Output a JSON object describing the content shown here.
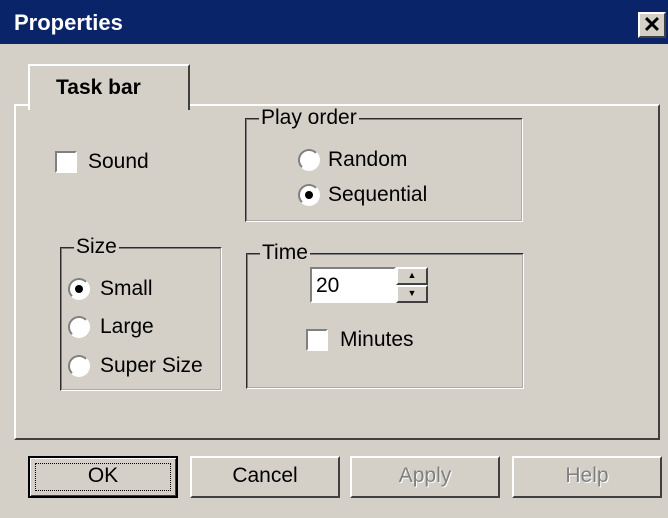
{
  "window": {
    "title": "Properties",
    "close_glyph": "✕"
  },
  "tabs": [
    {
      "label": "Task bar",
      "active": true
    }
  ],
  "sound": {
    "label": "Sound",
    "checked": false
  },
  "play_order": {
    "legend": "Play order",
    "options": [
      {
        "label": "Random",
        "selected": false
      },
      {
        "label": "Sequential",
        "selected": true
      }
    ]
  },
  "size": {
    "legend": "Size",
    "options": [
      {
        "label": "Small",
        "selected": true
      },
      {
        "label": "Large",
        "selected": false
      },
      {
        "label": "Super Size",
        "selected": false
      }
    ]
  },
  "time": {
    "legend": "Time",
    "value": "20",
    "minutes": {
      "label": "Minutes",
      "checked": false
    }
  },
  "buttons": {
    "ok": "OK",
    "cancel": "Cancel",
    "apply": "Apply",
    "help": "Help"
  },
  "colors": {
    "titlebar": "#0a246a",
    "face": "#d4d0c8"
  }
}
